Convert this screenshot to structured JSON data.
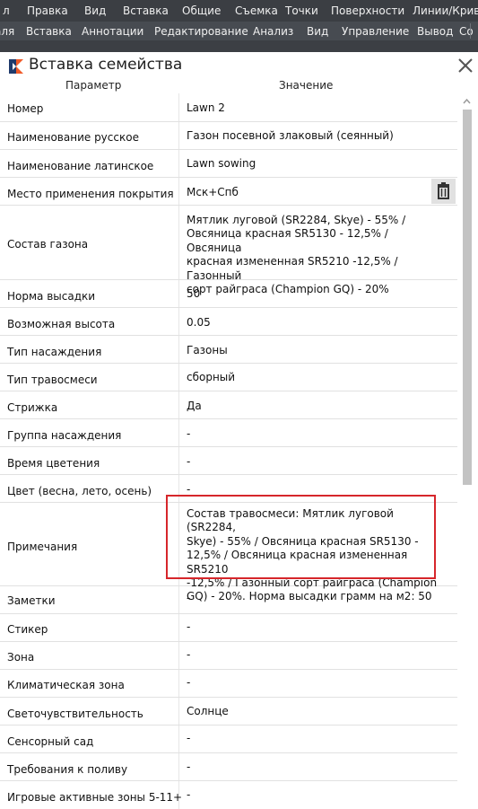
{
  "menubar_top": [
    "л",
    "Правка",
    "Вид",
    "Вставка",
    "Общие",
    "Съемка",
    "Точки",
    "Поверхности",
    "Линии/Кривые"
  ],
  "menubar_ribbon": [
    "аля",
    "Вставка",
    "Аннотации",
    "Редактирование",
    "Анализ",
    "Вид",
    "Управление",
    "Вывод",
    "Co"
  ],
  "dialog": {
    "title": "Вставка семейства",
    "col_param": "Параметр",
    "col_value": "Значение"
  },
  "rows": [
    {
      "key": "Номер",
      "value": "Lawn 2"
    },
    {
      "key": "Наименование русское",
      "value": "Газон посевной злаковый (сеянный)"
    },
    {
      "key": "Наименование латинское",
      "value": "Lawn sowing"
    },
    {
      "key": "Место применения покрытия",
      "value": "Мск+Спб"
    },
    {
      "key": "Состав газона",
      "value": "Мятлик луговой (SR2284, Skye) - 55% /\nОвсяница красная SR5130 - 12,5% / Овсяница\nкрасная измененная SR5210 -12,5% /  Газонный\nсорт райграса (Champion GQ) - 20%"
    },
    {
      "key": "Норма высадки",
      "value": "50"
    },
    {
      "key": "Возможная высота",
      "value": "0.05"
    },
    {
      "key": "Тип насаждения",
      "value": "Газоны"
    },
    {
      "key": "Тип травосмеси",
      "value": "сборный"
    },
    {
      "key": "Стрижка",
      "value": "Да"
    },
    {
      "key": "Группа насаждения",
      "value": "-"
    },
    {
      "key": "Время цветения",
      "value": "-"
    },
    {
      "key": "Цвет (весна, лето, осень)",
      "value": "-"
    },
    {
      "key": "Примечания",
      "value": "Состав травосмеси: Мятлик луговой (SR2284,\nSkye) - 55% / Овсяница красная SR5130 -\n12,5% / Овсяница красная измененная SR5210\n-12,5% /  Газонный сорт райграса (Champion\nGQ) - 20%. Норма высадки грамм на м2: 50"
    },
    {
      "key": "Заметки",
      "value": "-"
    },
    {
      "key": "Стикер",
      "value": "-"
    },
    {
      "key": "Зона",
      "value": "-"
    },
    {
      "key": "Климатическая зона",
      "value": "-"
    },
    {
      "key": "Светочувствительность",
      "value": "Солнце"
    },
    {
      "key": "Сенсорный сад",
      "value": "-"
    },
    {
      "key": "Требования к поливу",
      "value": "-"
    },
    {
      "key": "Игровые активные зоны 5-11+",
      "value": "-"
    }
  ],
  "icons": {
    "logo": "app-logo-icon",
    "close": "close-icon",
    "trash": "trash-icon",
    "scroll_up": "chevron-up-icon"
  },
  "colors": {
    "highlight": "#d6262b",
    "logo_orange": "#f05a28",
    "logo_navy": "#1f3a6b"
  }
}
